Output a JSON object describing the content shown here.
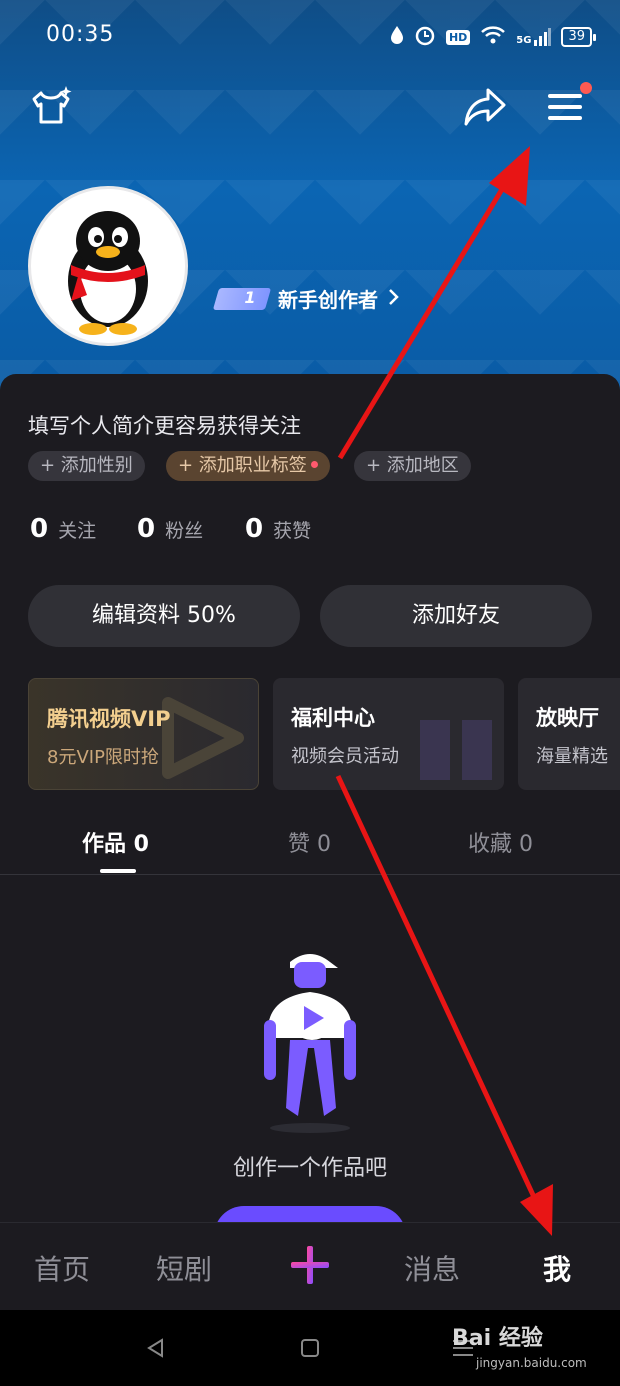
{
  "status_bar": {
    "time": "00:35",
    "network": "5G",
    "battery": "39",
    "hd": "HD"
  },
  "profile": {
    "creator_level": "1",
    "creator_label": "新手创作者",
    "bio_prompt": "填写个人简介更容易获得关注",
    "tags": [
      "+ 添加性别",
      "+ 添加职业标签",
      "+ 添加地区"
    ],
    "stats": [
      {
        "count": "0",
        "label": "关注"
      },
      {
        "count": "0",
        "label": "粉丝"
      },
      {
        "count": "0",
        "label": "获赞"
      }
    ],
    "buttons": {
      "edit": "编辑资料 50%",
      "add_friend": "添加好友"
    }
  },
  "cards": [
    {
      "title": "腾讯视频VIP",
      "sub": "8元VIP限时抢"
    },
    {
      "title": "福利中心",
      "sub": "视频会员活动"
    },
    {
      "title": "放映厅",
      "sub": "海量精选"
    }
  ],
  "tabs": [
    "作品 0",
    "赞 0",
    "收藏 0"
  ],
  "empty_state": {
    "text": "创作一个作品吧"
  },
  "bottom_nav": {
    "home": "首页",
    "short_drama": "短剧",
    "messages": "消息",
    "me": "我"
  },
  "watermark": {
    "main": "Bai 经验",
    "sub": "jingyan.baidu.com"
  },
  "colors": {
    "accent": "#6a4cff",
    "annotation_arrow": "#e81515",
    "vip_gold": "#f3cf8f"
  }
}
